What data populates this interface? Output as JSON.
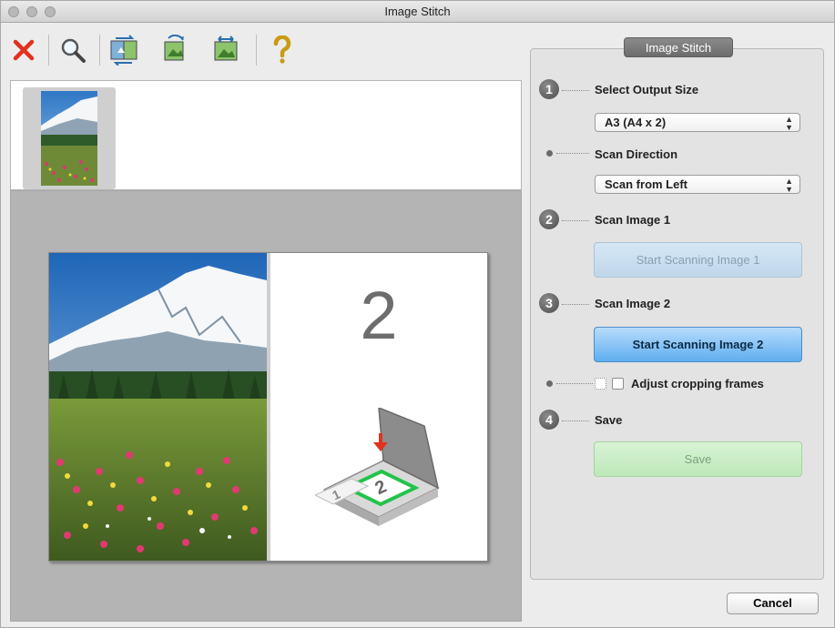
{
  "window": {
    "title": "Image Stitch"
  },
  "toolbar": {
    "items": [
      {
        "icon": "close-x-icon"
      },
      {
        "icon": "zoom-icon"
      },
      {
        "icon": "swap-images-icon"
      },
      {
        "icon": "rotate-image-icon"
      },
      {
        "icon": "adjust-image-icon"
      },
      {
        "icon": "help-icon"
      }
    ]
  },
  "preview": {
    "placeholder_number": "2"
  },
  "panel": {
    "tab_label": "Image Stitch",
    "steps": [
      {
        "number": "1",
        "label": "Select Output Size",
        "select_value": "A3 (A4 x 2)"
      },
      {
        "label": "Scan Direction",
        "select_value": "Scan from Left"
      },
      {
        "number": "2",
        "label": "Scan Image 1",
        "button_label": "Start Scanning Image 1"
      },
      {
        "number": "3",
        "label": "Scan Image 2",
        "button_label": "Start Scanning Image 2"
      },
      {
        "label": "Adjust cropping frames"
      },
      {
        "number": "4",
        "label": "Save",
        "button_label": "Save"
      }
    ]
  },
  "footer": {
    "cancel_label": "Cancel"
  },
  "colors": {
    "accent_blue": "#5faef0",
    "disabled_blue": "#bfd7ea",
    "disabled_green": "#bde8b8",
    "close_red": "#e0321f"
  }
}
